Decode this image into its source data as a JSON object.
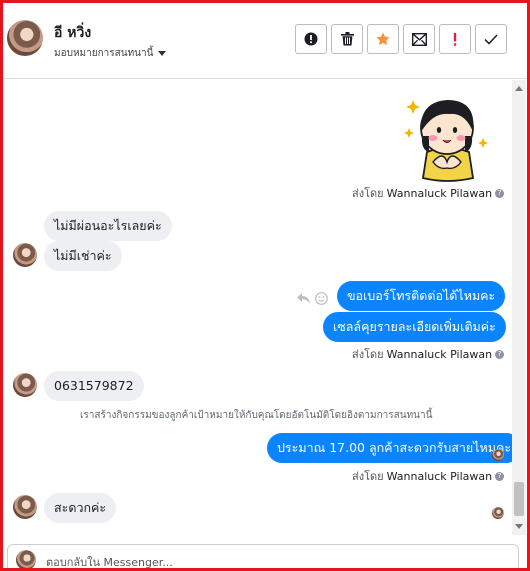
{
  "header": {
    "contact_name": "อี หวิ่ง",
    "assignment_label": "มอบหมายการสนทนานี้",
    "toolbar": [
      "info-icon",
      "trash-icon",
      "star-icon",
      "mark-unread-icon",
      "priority-icon",
      "check-icon"
    ]
  },
  "colors": {
    "frame_border": "#e8141b",
    "outgoing_bubble": "#0a84ff",
    "incoming_bubble": "#eeeff2",
    "star_accent": "#f7923a",
    "priority_accent": "#e41e3f"
  },
  "messages": [
    {
      "id": "sticker",
      "type": "sticker",
      "direction": "out",
      "sticker": "cartoon-girl-sparkles"
    },
    {
      "id": "sent1",
      "type": "sent_by",
      "prefix": "ส่งโดย",
      "name": "Wannaluck Pilawan"
    },
    {
      "id": "m1",
      "direction": "in",
      "text": "ไม่มีผ่อนอะไรเลยค่ะ"
    },
    {
      "id": "m2",
      "direction": "in",
      "text": "ไม่มีเช่าค่ะ"
    },
    {
      "id": "m3",
      "direction": "out",
      "text": "ขอเบอร์โทรติดต่อได้ไหมคะ"
    },
    {
      "id": "m4",
      "direction": "out",
      "text": "เซลล์คุยรายละเอียดเพิ่มเติมค่ะ"
    },
    {
      "id": "sent2",
      "type": "sent_by",
      "prefix": "ส่งโดย",
      "name": "Wannaluck Pilawan"
    },
    {
      "id": "m5",
      "direction": "in",
      "text": "0631579872"
    },
    {
      "id": "note",
      "type": "system",
      "text": "เราสร้างกิจกรรมของลูกค้าเป้าหมายให้กับคุณโดยอัตโนมัติโดยอิงตามการสนทนานี้"
    },
    {
      "id": "m6",
      "direction": "out",
      "text": "ประมาณ 17.00 ลูกค้าสะดวกรับสายไหมคะ"
    },
    {
      "id": "sent3",
      "type": "sent_by",
      "prefix": "ส่งโดย",
      "name": "Wannaluck Pilawan"
    },
    {
      "id": "m7",
      "direction": "in",
      "text": "สะดวกค่ะ"
    }
  ],
  "reply": {
    "placeholder": "ตอบกลับใน Messenger..."
  }
}
